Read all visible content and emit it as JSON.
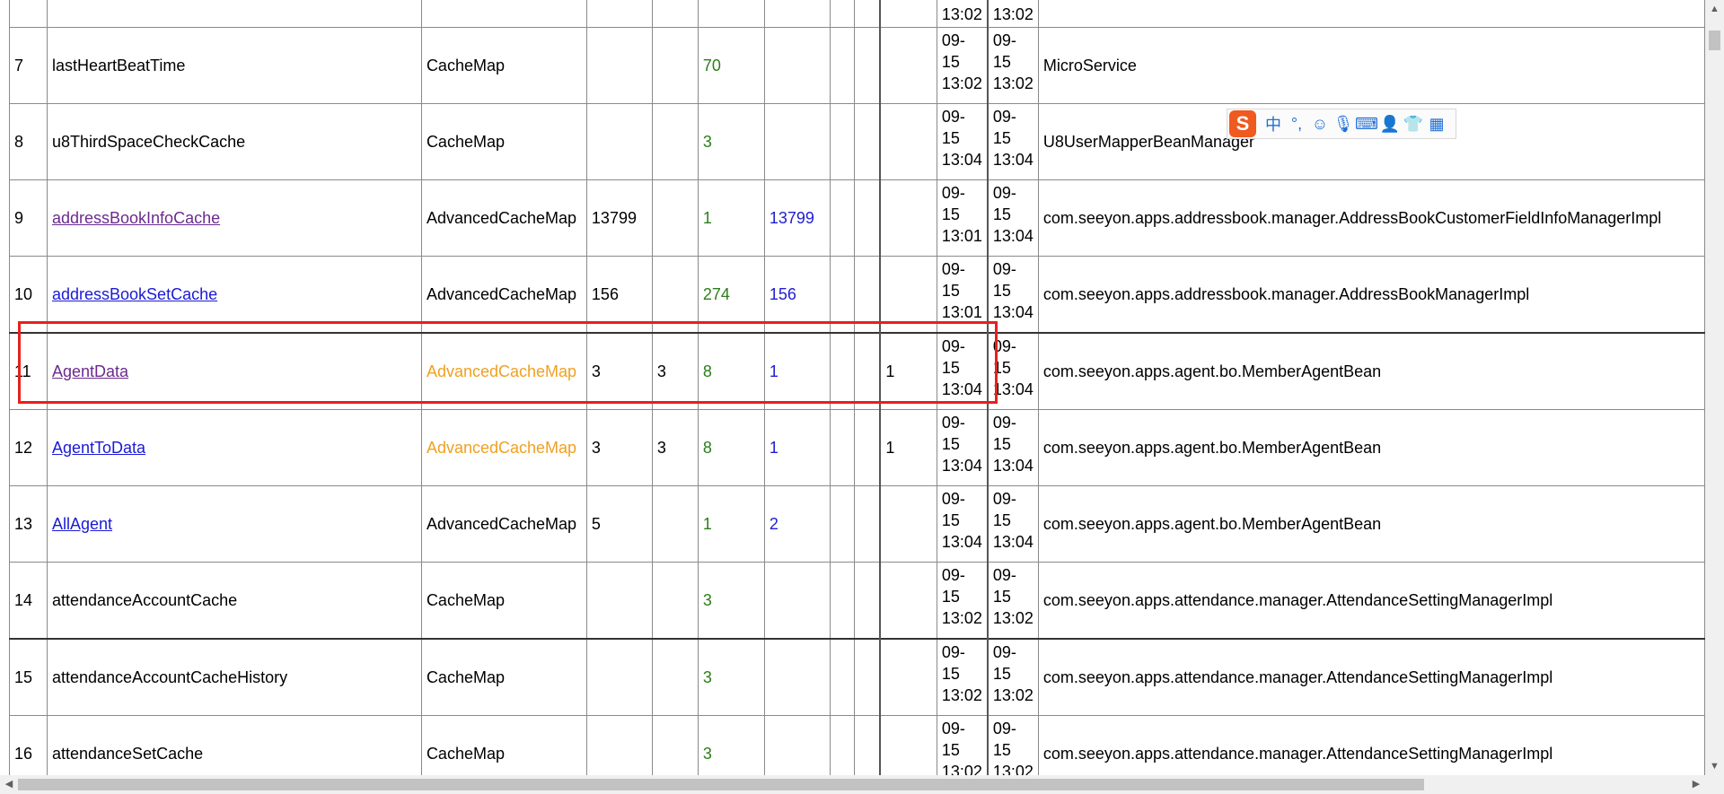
{
  "partial_row": {
    "created": [
      "13:02"
    ],
    "updated": [
      "13:02"
    ]
  },
  "rows": [
    {
      "idx": "7",
      "name": "lastHeartBeatTime",
      "name_style": "plain",
      "type": "CacheMap",
      "type_style": "plain",
      "c1": "",
      "c2": "",
      "c3": "70",
      "c4": "",
      "c5": "",
      "c6": "",
      "c7": "",
      "created": [
        "09-",
        "15",
        "13:02"
      ],
      "updated": [
        "09-",
        "15",
        "13:02"
      ],
      "cls": "MicroService"
    },
    {
      "idx": "8",
      "name": "u8ThirdSpaceCheckCache",
      "name_style": "plain",
      "type": "CacheMap",
      "type_style": "plain",
      "c1": "",
      "c2": "",
      "c3": "3",
      "c4": "",
      "c5": "",
      "c6": "",
      "c7": "",
      "created": [
        "09-",
        "15",
        "13:04"
      ],
      "updated": [
        "09-",
        "15",
        "13:04"
      ],
      "cls": "U8UserMapperBeanManager"
    },
    {
      "idx": "9",
      "name": "addressBookInfoCache",
      "name_style": "visited",
      "type": "AdvancedCacheMap",
      "type_style": "plain",
      "c1": "13799",
      "c2": "",
      "c3": "1",
      "c4": "13799",
      "c5": "",
      "c6": "",
      "c7": "",
      "created": [
        "09-",
        "15",
        "13:01"
      ],
      "updated": [
        "09-",
        "15",
        "13:04"
      ],
      "cls": "com.seeyon.apps.addressbook.manager.AddressBookCustomerFieldInfoManagerImpl"
    },
    {
      "idx": "10",
      "name": "addressBookSetCache",
      "name_style": "link",
      "type": "AdvancedCacheMap",
      "type_style": "plain",
      "c1": "156",
      "c2": "",
      "c3": "274",
      "c4": "156",
      "c5": "",
      "c6": "",
      "c7": "",
      "created": [
        "09-",
        "15",
        "13:01"
      ],
      "updated": [
        "09-",
        "15",
        "13:04"
      ],
      "cls": "com.seeyon.apps.addressbook.manager.AddressBookManagerImpl"
    },
    {
      "idx": "11",
      "name": "AgentData",
      "name_style": "visited",
      "type": "AdvancedCacheMap",
      "type_style": "orange",
      "c1": "3",
      "c2": "3",
      "c3": "8",
      "c4": "1",
      "c5": "",
      "c6": "",
      "c7": "1",
      "created": [
        "09-",
        "15",
        "13:04"
      ],
      "updated": [
        "09-",
        "15",
        "13:04"
      ],
      "cls": "com.seeyon.apps.agent.bo.MemberAgentBean",
      "thick": true
    },
    {
      "idx": "12",
      "name": "AgentToData",
      "name_style": "link",
      "type": "AdvancedCacheMap",
      "type_style": "orange",
      "c1": "3",
      "c2": "3",
      "c3": "8",
      "c4": "1",
      "c5": "",
      "c6": "",
      "c7": "1",
      "created": [
        "09-",
        "15",
        "13:04"
      ],
      "updated": [
        "09-",
        "15",
        "13:04"
      ],
      "cls": "com.seeyon.apps.agent.bo.MemberAgentBean"
    },
    {
      "idx": "13",
      "name": "AllAgent",
      "name_style": "link",
      "type": "AdvancedCacheMap",
      "type_style": "plain",
      "c1": "5",
      "c2": "",
      "c3": "1",
      "c4": "2",
      "c5": "",
      "c6": "",
      "c7": "",
      "created": [
        "09-",
        "15",
        "13:04"
      ],
      "updated": [
        "09-",
        "15",
        "13:04"
      ],
      "cls": "com.seeyon.apps.agent.bo.MemberAgentBean"
    },
    {
      "idx": "14",
      "name": "attendanceAccountCache",
      "name_style": "plain",
      "type": "CacheMap",
      "type_style": "plain",
      "c1": "",
      "c2": "",
      "c3": "3",
      "c4": "",
      "c5": "",
      "c6": "",
      "c7": "",
      "created": [
        "09-",
        "15",
        "13:02"
      ],
      "updated": [
        "09-",
        "15",
        "13:02"
      ],
      "cls": "com.seeyon.apps.attendance.manager.AttendanceSettingManagerImpl"
    },
    {
      "idx": "15",
      "name": "attendanceAccountCacheHistory",
      "name_style": "plain",
      "type": "CacheMap",
      "type_style": "plain",
      "c1": "",
      "c2": "",
      "c3": "3",
      "c4": "",
      "c5": "",
      "c6": "",
      "c7": "",
      "created": [
        "09-",
        "15",
        "13:02"
      ],
      "updated": [
        "09-",
        "15",
        "13:02"
      ],
      "cls": "com.seeyon.apps.attendance.manager.AttendanceSettingManagerImpl",
      "thick": true
    },
    {
      "idx": "16",
      "name": "attendanceSetCache",
      "name_style": "plain",
      "type": "CacheMap",
      "type_style": "plain",
      "c1": "",
      "c2": "",
      "c3": "3",
      "c4": "",
      "c5": "",
      "c6": "",
      "c7": "",
      "created": [
        "09-",
        "15",
        "13:02"
      ],
      "updated": [
        "09-",
        "15",
        "13:02"
      ],
      "cls": "com.seeyon.apps.attendance.manager.AttendanceSettingManagerImpl"
    }
  ],
  "ime_toolbar": {
    "logo": "S",
    "mode_label": "中",
    "punct_label": "°,",
    "icons": [
      "emoji-icon",
      "microphone-icon",
      "keyboard-icon",
      "user-icon",
      "shirt-icon",
      "grid-icon"
    ]
  },
  "colors": {
    "highlight": "#e8201c",
    "link": "#1a1ad6",
    "visited": "#6b2a8f",
    "green": "#2e7d1a",
    "orange": "#f0a020"
  }
}
